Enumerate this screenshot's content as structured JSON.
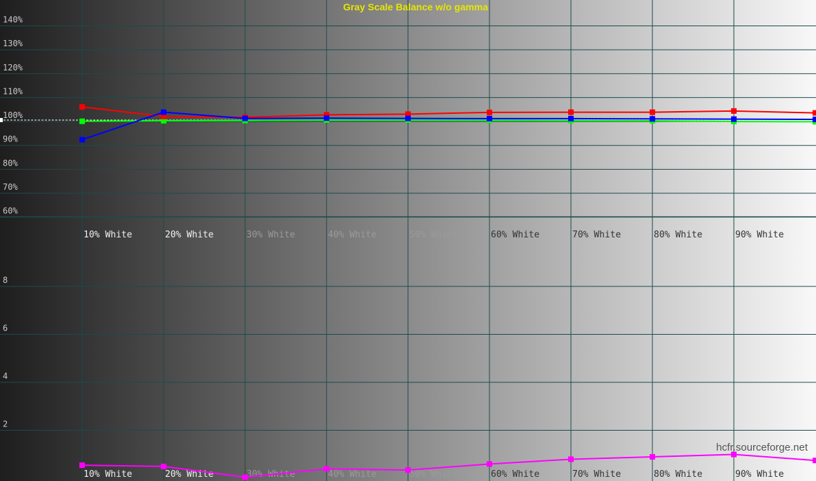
{
  "chart_data": [
    {
      "type": "line",
      "title": "Gray Scale Balance w/o gamma",
      "xlabel": "",
      "ylabel": "",
      "categories": [
        "",
        "10% White",
        "20% White",
        "30% White",
        "40% White",
        "50% White",
        "60% White",
        "70% White",
        "80% White",
        "90% White",
        ""
      ],
      "y_ticks": [
        "140%",
        "130%",
        "120%",
        "110%",
        "100%",
        "90%",
        "80%",
        "70%",
        "60%"
      ],
      "ylim": [
        55,
        145
      ],
      "reference_line": 98,
      "grid": true,
      "series": [
        {
          "color": "#ff0000",
          "values": [
            null,
            103.5,
            99.5,
            99.2,
            100.2,
            100.5,
            101.2,
            101.3,
            101.3,
            101.8,
            101
          ]
        },
        {
          "color": "#00ff00",
          "values": [
            null,
            97.5,
            97.7,
            97.8,
            98.0,
            98.0,
            97.9,
            97.8,
            97.7,
            97.4,
            97.3
          ]
        },
        {
          "color": "#0000ff",
          "values": [
            null,
            89.8,
            101.3,
            98.7,
            98.8,
            98.7,
            98.6,
            98.6,
            98.5,
            98.4,
            98.3
          ]
        }
      ]
    },
    {
      "type": "line",
      "title": "",
      "categories": [
        "",
        "10% White",
        "20% White",
        "30% White",
        "40% White",
        "50% White",
        "60% White",
        "70% White",
        "80% White",
        "90% White",
        ""
      ],
      "y_ticks": [
        "8",
        "6",
        "4",
        "2"
      ],
      "ylim": [
        0,
        10
      ],
      "grid": true,
      "series": [
        {
          "color": "#ff00ff",
          "values": [
            null,
            0.6,
            0.55,
            0.1,
            0.45,
            0.4,
            0.65,
            0.85,
            0.95,
            1.05,
            0.8
          ]
        }
      ]
    }
  ],
  "credit": "hcfr.sourceforge.net",
  "colors": {
    "grid": "#1e4a4a",
    "title": "#e6e600",
    "credit": "#555555",
    "reference": "#ffffff"
  }
}
